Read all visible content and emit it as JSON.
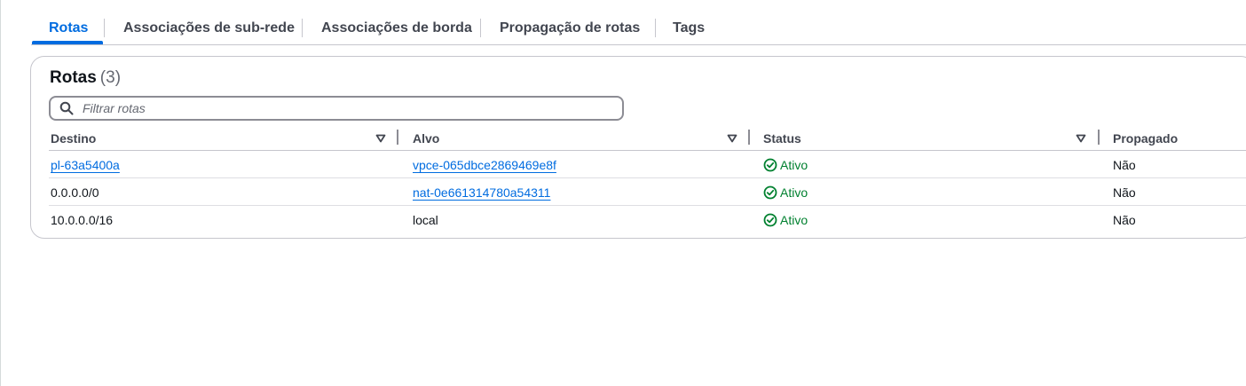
{
  "tabs": [
    {
      "label": "Rotas",
      "active": true
    },
    {
      "label": "Associações de sub-rede",
      "active": false
    },
    {
      "label": "Associações de borda",
      "active": false
    },
    {
      "label": "Propagação de rotas",
      "active": false
    },
    {
      "label": "Tags",
      "active": false
    }
  ],
  "routes": {
    "title": "Rotas",
    "count": "(3)",
    "filter": {
      "placeholder": "Filtrar rotas",
      "value": ""
    },
    "columns": [
      "Destino",
      "Alvo",
      "Status",
      "Propagado"
    ],
    "rows": [
      {
        "destination": "pl-63a5400a",
        "destination_link": true,
        "target": "vpce-065dbce2869469e8f",
        "target_link": true,
        "status": "Ativo",
        "propagated": "Não"
      },
      {
        "destination": "0.0.0.0/0",
        "destination_link": false,
        "target": "nat-0e661314780a54311",
        "target_link": true,
        "status": "Ativo",
        "propagated": "Não"
      },
      {
        "destination": "10.0.0.0/16",
        "destination_link": false,
        "target": "local",
        "target_link": false,
        "status": "Ativo",
        "propagated": "Não"
      }
    ]
  },
  "icons": {
    "search": "search-icon",
    "sort": "caret-down-icon",
    "status": "status-positive-icon"
  },
  "colors": {
    "accent": "#006ce0",
    "success": "#00802f",
    "text": "#0f141a",
    "muted": "#424650"
  }
}
